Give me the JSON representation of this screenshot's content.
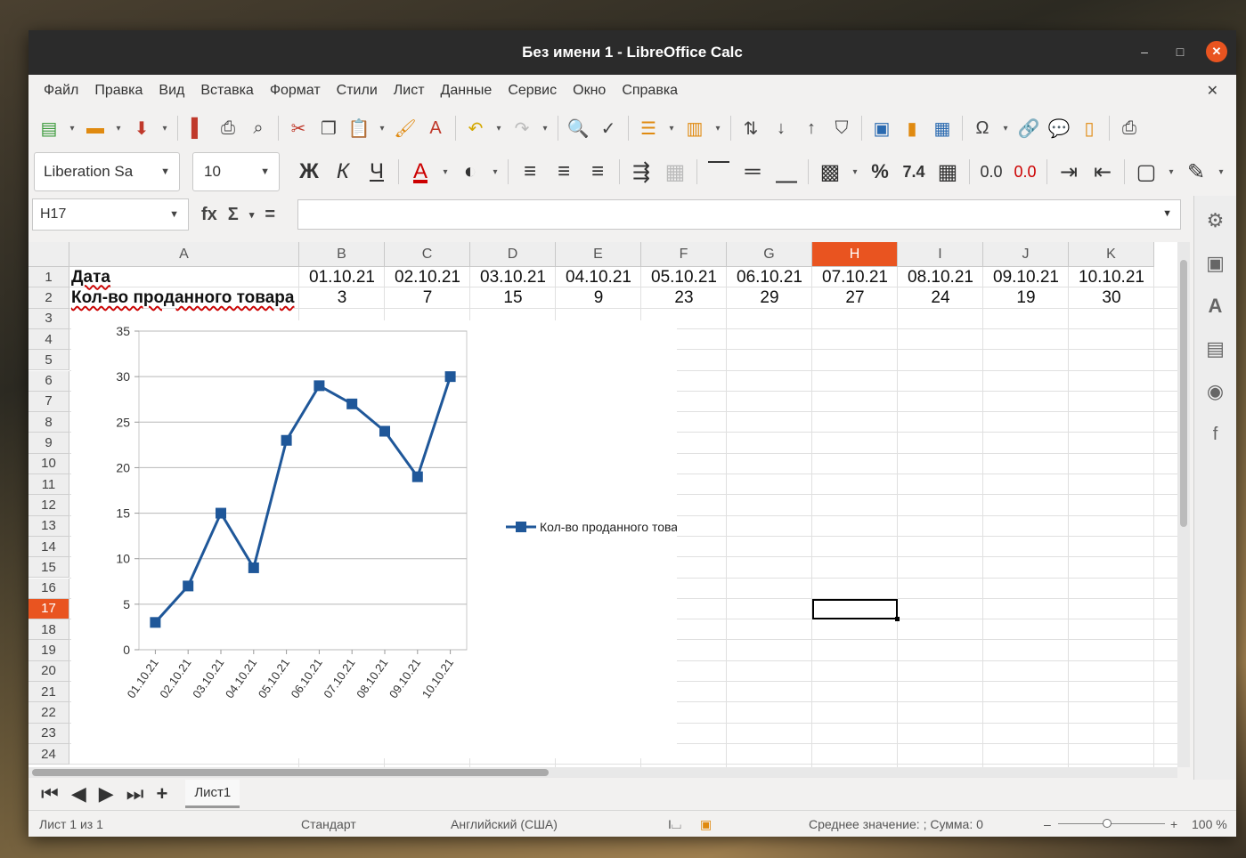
{
  "window": {
    "title": "Без имени 1 - LibreOffice Calc",
    "min_glyph": "–",
    "max_glyph": "□",
    "close_glyph": "✕"
  },
  "menu": {
    "items": [
      "Файл",
      "Правка",
      "Вид",
      "Вставка",
      "Формат",
      "Стили",
      "Лист",
      "Данные",
      "Сервис",
      "Окно",
      "Справка"
    ],
    "close_glyph": "✕"
  },
  "format": {
    "font_name": "Liberation Sa",
    "font_size": "10",
    "bold": "Ж",
    "italic": "К",
    "underline": "Ч",
    "percent": "%",
    "number": "7.4",
    "add_decimal": "0.0",
    "del_decimal": "0.0"
  },
  "formula": {
    "cell_ref": "H17",
    "fx": "fx",
    "sum": "Σ",
    "equals": "="
  },
  "columns": [
    "A",
    "B",
    "C",
    "D",
    "E",
    "F",
    "G",
    "H",
    "I",
    "J",
    "K"
  ],
  "selected_column": "H",
  "rows": [
    "1",
    "2",
    "3",
    "4",
    "5",
    "6",
    "7",
    "8",
    "9",
    "10",
    "11",
    "12",
    "13",
    "14",
    "15",
    "16",
    "17",
    "18",
    "19",
    "20",
    "21",
    "22",
    "23",
    "24"
  ],
  "selected_row": "17",
  "cells": {
    "a1": "Дата",
    "a2": "Кол-во проданного товара",
    "dates": [
      "01.10.21",
      "02.10.21",
      "03.10.21",
      "04.10.21",
      "05.10.21",
      "06.10.21",
      "07.10.21",
      "08.10.21",
      "09.10.21",
      "10.10.21"
    ],
    "counts": [
      "3",
      "7",
      "15",
      "9",
      "23",
      "29",
      "27",
      "24",
      "19",
      "30"
    ]
  },
  "chart_data": {
    "type": "line",
    "categories": [
      "01.10.21",
      "02.10.21",
      "03.10.21",
      "04.10.21",
      "05.10.21",
      "06.10.21",
      "07.10.21",
      "08.10.21",
      "09.10.21",
      "10.10.21"
    ],
    "series": [
      {
        "name": "Кол-во проданного товара",
        "values": [
          3,
          7,
          15,
          9,
          23,
          29,
          27,
          24,
          19,
          30
        ],
        "color": "#1f5799"
      }
    ],
    "ylim": [
      0,
      35
    ],
    "yticks": [
      "0",
      "5",
      "10",
      "15",
      "20",
      "25",
      "30",
      "35"
    ],
    "grid": true,
    "legend": "right"
  },
  "sheet_tabs": [
    "Лист1"
  ],
  "status": {
    "sheet_info": "Лист 1 из 1",
    "style": "Стандарт",
    "language": "Английский (США)",
    "summary": "Среднее значение: ; Сумма: 0",
    "zoom": "100 %"
  },
  "colors": {
    "accent": "#e95420",
    "series": "#1f5799"
  }
}
